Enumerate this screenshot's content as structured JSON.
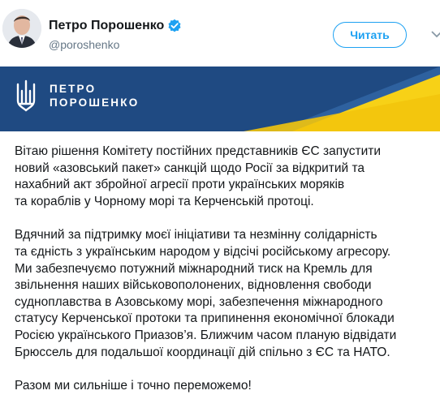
{
  "user": {
    "name": "Петро Порошенко",
    "handle": "@poroshenko"
  },
  "follow_button": {
    "label": "Читать"
  },
  "banner": {
    "line1": "ПЕТРО",
    "line2": "ПОРОШЕНКО"
  },
  "tweet": {
    "paragraph1": [
      "Вітаю рішення Комітету постійних представників ЄС запустити",
      "новий «азовський пакет» санкцій щодо Росії за відкритий та",
      "нахабний акт збройної агресії проти українських моряків",
      "та кораблів у Чорному морі та Керченській протоці."
    ],
    "paragraph2": [
      "Вдячний за підтримку моєї ініціативи та незмінну солідарність",
      "та єдність з українським народом у відсічі російському агресору.",
      "Ми забезпечуємо потужний міжнародний тиск на Кремль для",
      "звільнення наших військовополонених, відновлення свободи",
      "судноплавства в Азовському морі, забезпечення міжнародного",
      "статусу Керченської протоки та припинення економічної блокади",
      "Росією українського Приазов’я. Ближчим часом планую відвідати",
      "Брюссель для подальшої координації дій спільно з ЄС та НАТО."
    ],
    "paragraph3": [
      "Разом ми сильніше і точно переможемо!"
    ]
  },
  "colors": {
    "brand_blue": "#1da1f2",
    "banner_blue": "#1f4a82",
    "banner_yellow": "#f7d117"
  },
  "icons": {
    "verified": "verified-badge-icon",
    "caret": "chevron-down-icon",
    "emblem": "trident-emblem-icon"
  }
}
